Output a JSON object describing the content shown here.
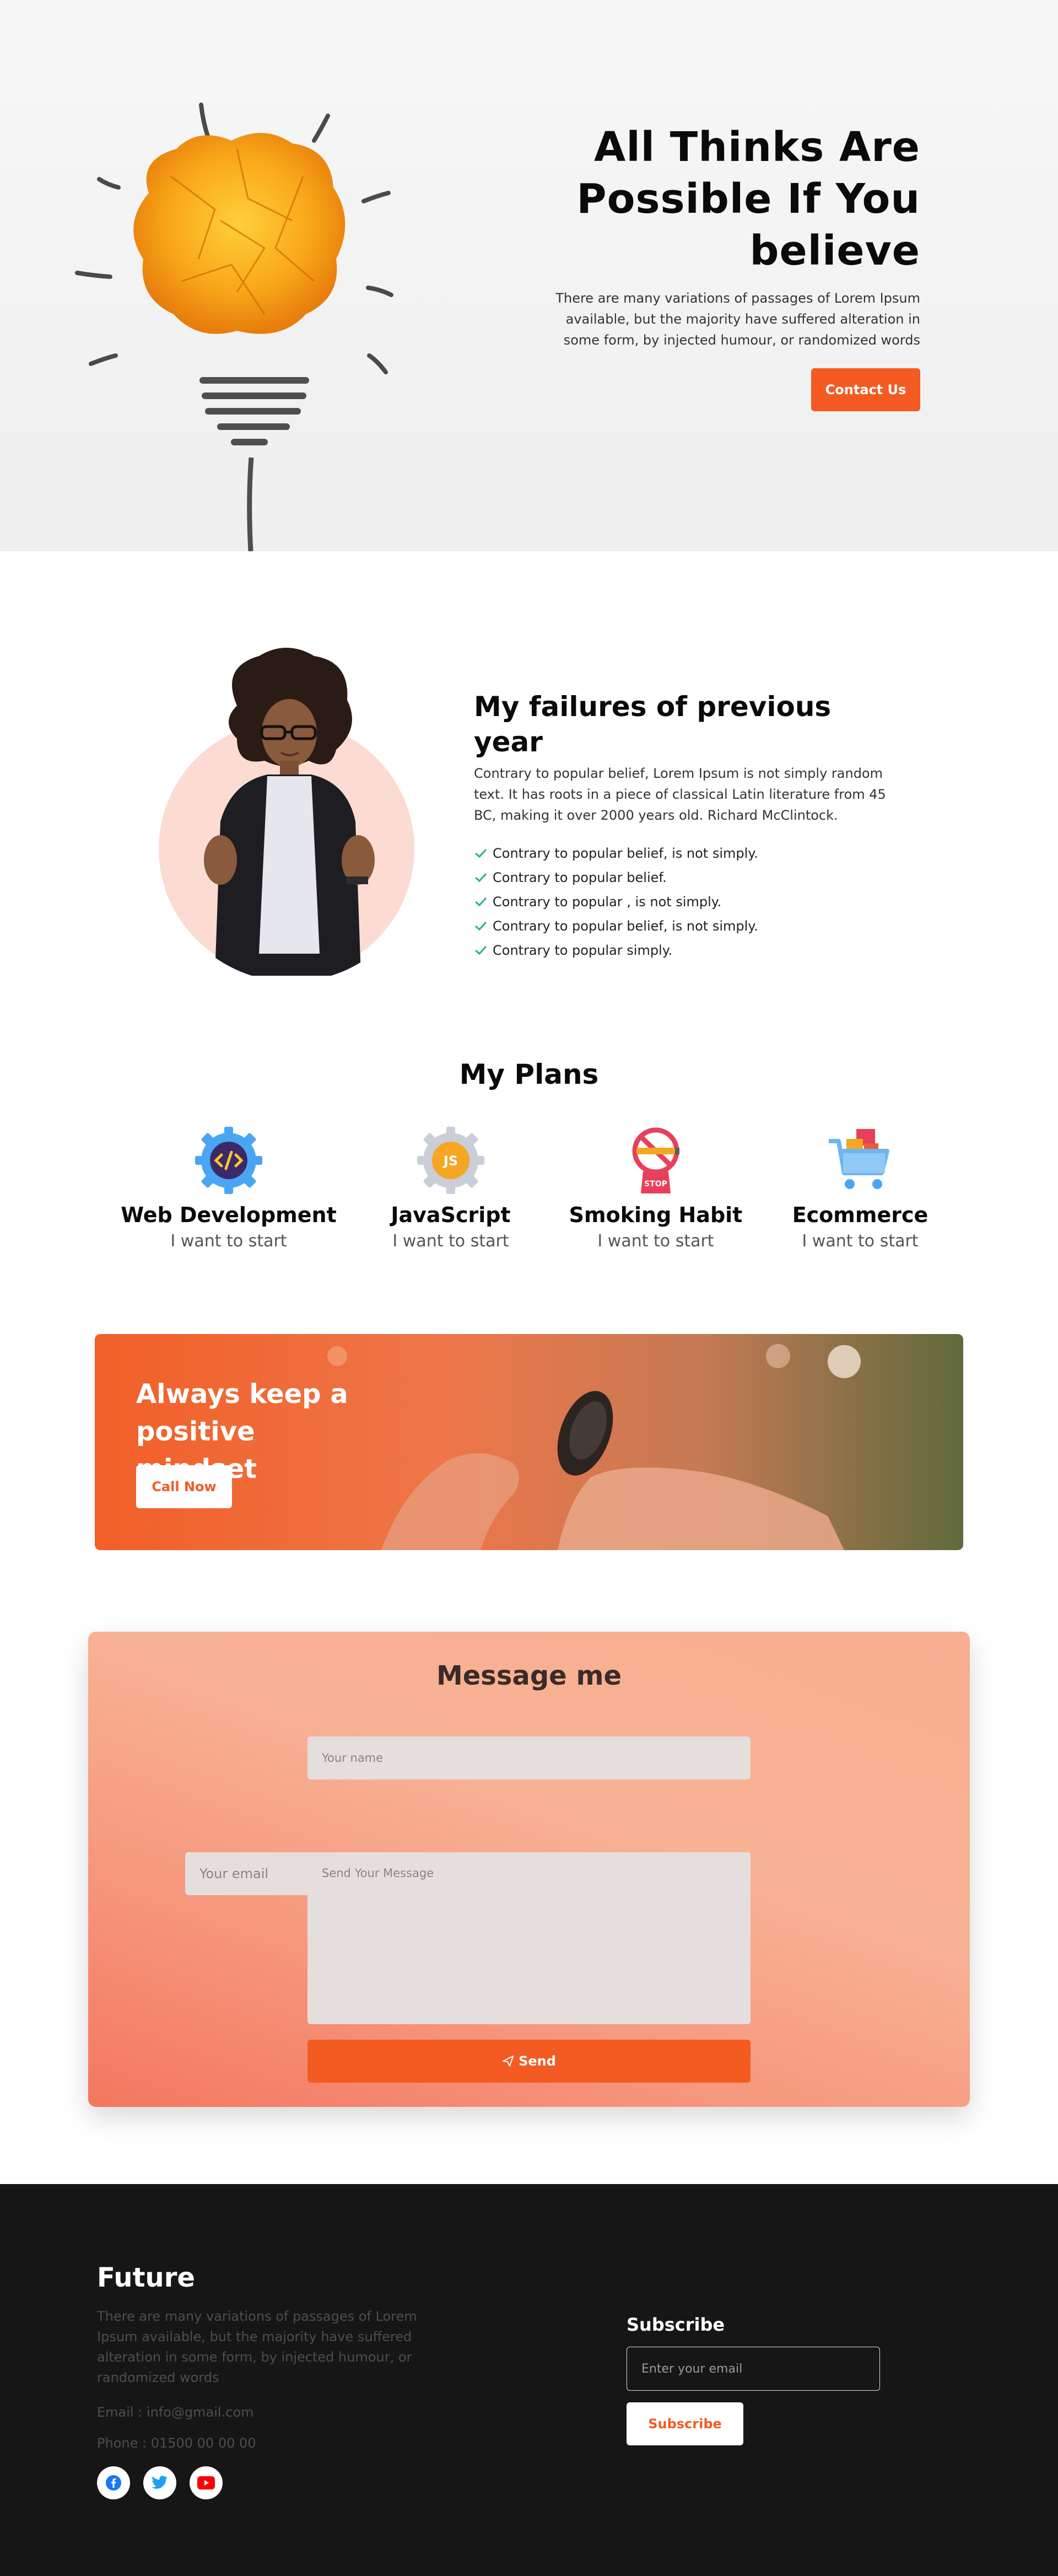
{
  "hero": {
    "title_line1": "All Thinks Are",
    "title_line2": "Possible If You",
    "title_line3": "believe",
    "description": "There are many variations of passages of Lorem Ipsum available, but the majority have suffered alteration in some form, by injected humour, or randomized words",
    "cta_label": "Contact Us"
  },
  "failures": {
    "title": "My failures of previous year",
    "description": "Contrary to popular belief, Lorem Ipsum is not simply random text. It has roots in a piece of classical Latin literature from 45 BC, making it over 2000 years old. Richard McClintock.",
    "items": [
      "Contrary to popular belief, is not simply.",
      "Contrary to popular belief.",
      "Contrary to popular , is not simply.",
      "Contrary to popular belief, is not simply.",
      "Contrary to popular simply."
    ]
  },
  "plans": {
    "title": "My Plans",
    "items": [
      {
        "name": "Web Development",
        "subtitle": "I want to start",
        "icon": "code-gear-icon"
      },
      {
        "name": "JavaScript",
        "subtitle": "I want to start",
        "icon": "js-gear-icon"
      },
      {
        "name": "Smoking Habit",
        "subtitle": "I want to start",
        "icon": "no-smoking-icon"
      },
      {
        "name": "Ecommerce",
        "subtitle": "I want to start",
        "icon": "shopping-cart-icon"
      }
    ]
  },
  "banner": {
    "title_line1": "Always keep a positive",
    "title_line2": "mindset",
    "cta_label": "Call Now"
  },
  "contact": {
    "title": "Message me",
    "name_placeholder": "Your name",
    "email_placeholder": "Your email",
    "message_placeholder": "Send Your Message",
    "send_label": "Send"
  },
  "footer": {
    "brand": "Future",
    "description": "There are many variations of passages of Lorem Ipsum available, but the majority have suffered alteration in some form, by injected humour, or randomized words",
    "email": "Email : info@gmail.com",
    "phone": "Phone : 01500 00 00 00",
    "subscribe_title": "Subscribe",
    "subscribe_placeholder": "Enter your email",
    "subscribe_label": "Subscribe",
    "socials": [
      "facebook-icon",
      "twitter-icon",
      "youtube-icon"
    ]
  },
  "colors": {
    "accent": "#f35b22",
    "check": "#1fb38a",
    "footer_bg": "#161616"
  }
}
